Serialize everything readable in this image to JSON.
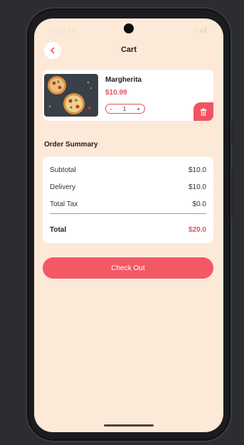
{
  "status_bar": {
    "time": "10:15 AM",
    "icons": "▾◢▮"
  },
  "header": {
    "back_icon": "chevron-left-icon",
    "title": "Cart"
  },
  "cart": {
    "items": [
      {
        "name": "Margherita",
        "price": "$10.99",
        "quantity": "1",
        "minus": "-",
        "plus": "+"
      }
    ]
  },
  "summary": {
    "title": "Order Summary",
    "subtotal_label": "Subtotal",
    "subtotal_value": "$10.0",
    "delivery_label": "Delivery",
    "delivery_value": "$10.0",
    "tax_label": "Total Tax",
    "tax_value": "$0.0",
    "total_label": "Total",
    "total_value": "$20.0"
  },
  "checkout": {
    "label": "Check Out"
  },
  "colors": {
    "background": "#fde9d8",
    "accent": "#f25965",
    "price": "#e5505e",
    "card": "#ffffff"
  }
}
